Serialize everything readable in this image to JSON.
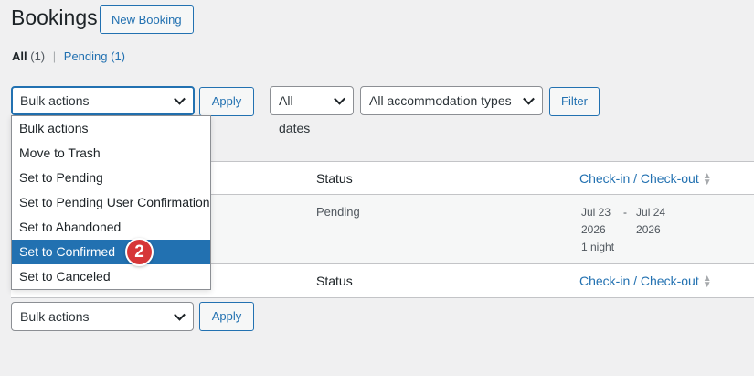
{
  "header": {
    "title": "Bookings",
    "new_button": "New Booking"
  },
  "views": {
    "all_label": "All",
    "all_count": "(1)",
    "separator": "|",
    "pending_label": "Pending",
    "pending_count": "(1)"
  },
  "top_actions": {
    "bulk_select": "Bulk actions",
    "apply": "Apply",
    "dates_select": "All dates",
    "accommodation_select": "All accommodation types",
    "filter": "Filter"
  },
  "dropdown": {
    "options": [
      "Bulk actions",
      "Move to Trash",
      "Set to Pending",
      "Set to Pending User Confirmation",
      "Set to Abandoned",
      "Set to Confirmed",
      "Set to Canceled"
    ],
    "selected": "Set to Confirmed",
    "badge": "2"
  },
  "table": {
    "columns": {
      "status": "Status",
      "checkin": "Check-in / Check-out"
    },
    "row": {
      "status": "Pending",
      "checkin_date": "Jul 23",
      "checkin_year": "2026",
      "dash": "-",
      "checkout_date": "Jul 24",
      "checkout_year": "2026",
      "nights": "1 night"
    }
  },
  "bottom_actions": {
    "bulk_select": "Bulk actions",
    "apply": "Apply"
  },
  "colors": {
    "accent": "#2271b1",
    "badge": "#d63638"
  }
}
